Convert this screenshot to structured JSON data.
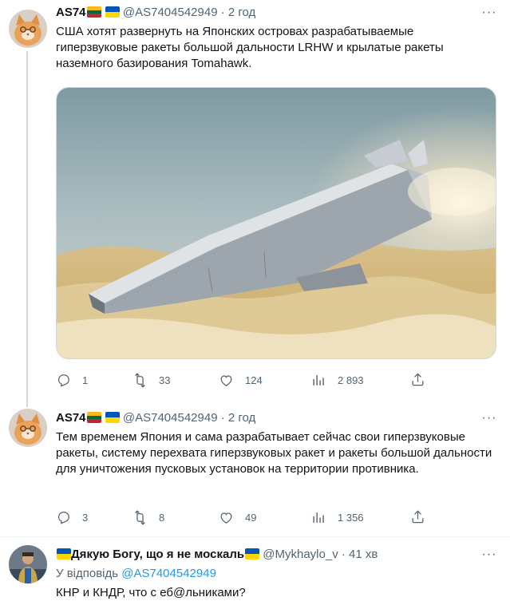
{
  "tweets": [
    {
      "name": "AS74",
      "handle": "@AS7404542949",
      "time": "· 2 год",
      "text": "США хотят развернуть на Японских островах разрабатываемые гиперзвуковые ракеты большой дальности LRHW и крылатые ракеты наземного базирования Tomahawk.",
      "media": "image of missile flying over clouds",
      "replies": "1",
      "retweets": "33",
      "likes": "124",
      "views": "2 893"
    },
    {
      "name": "AS74",
      "handle": "@AS7404542949",
      "time": "· 2 год",
      "text": "Тем временем Япония и сама разрабатывает сейчас свои гиперзвуковые ракеты, систему перехвата гиперзвуковых ракет и ракеты большой дальности для уничтожения пусковых установок на территории противника.",
      "replies": "3",
      "retweets": "8",
      "likes": "49",
      "views": "1 356"
    },
    {
      "name": "Дякую Богу, що я не москаль",
      "handle": "@Mykhaylo_v",
      "time": "· 41 хв",
      "reply_prefix": "У відповідь",
      "reply_to": "@AS7404542949",
      "text": "КНР и КНДР, что с еб@льниками?"
    }
  ],
  "icons": {
    "reply": "reply-icon",
    "retweet": "retweet-icon",
    "like": "like-icon",
    "views": "views-icon",
    "share": "share-icon",
    "more": "more-icon"
  },
  "colors": {
    "text": "#0f1419",
    "secondary": "#536471",
    "link": "#1d9bf0",
    "divider": "#eff3f4"
  }
}
